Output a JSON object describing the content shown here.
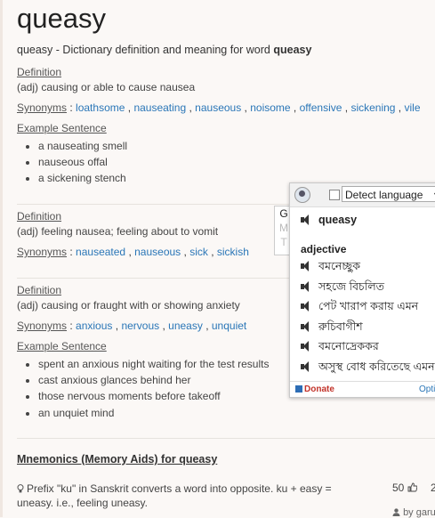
{
  "title": "queasy",
  "subtitle": {
    "text": "queasy - Dictionary definition and meaning for word ",
    "word": "queasy"
  },
  "labels": {
    "definition": "Definition",
    "synonyms": "Synonyms",
    "example": "Example Sentence",
    "synonyms_sep": " : "
  },
  "senses": [
    {
      "def": "(adj) causing or able to cause nausea",
      "synonyms": [
        "loathsome",
        "nauseating",
        "nauseous",
        "noisome",
        "offensive",
        "sickening",
        "vile"
      ],
      "examples": [
        "a nauseating smell",
        "nauseous offal",
        "a sickening stench"
      ]
    },
    {
      "def": "(adj) feeling nausea; feeling about to vomit",
      "synonyms": [
        "nauseated",
        "nauseous",
        "sick",
        "sickish"
      ],
      "examples": []
    },
    {
      "def": "(adj) causing or fraught with or showing anxiety",
      "synonyms": [
        "anxious",
        "nervous",
        "uneasy",
        "unquiet"
      ],
      "examples": [
        "spent an anxious night waiting for the test results",
        "cast anxious glances behind her",
        "those nervous moments before takeoff",
        "an unquiet mind"
      ]
    }
  ],
  "mnemonics": {
    "title": "Mnemonics (Memory Aids) for queasy",
    "text": "Prefix \"ku\" in Sanskrit converts a word into opposite. ku + easy = uneasy. i.e., feeling uneasy.",
    "votes": "50",
    "votes_other": "2",
    "author": "by garu"
  },
  "translate_popup": {
    "detect_label": "Detect language",
    "gmt": [
      "G",
      "M",
      "T"
    ],
    "word": "queasy",
    "pos": "adjective",
    "translations": [
      "বমনেচ্ছুক",
      "সহজে বিচলিত",
      "পেট খারাপ করায় এমন",
      "রুচিবাগীশ",
      "বমনোদ্রেককর",
      "অসুস্থ বোধ করিতেছে এমন"
    ],
    "donate": "Donate",
    "options": "Opti"
  },
  "colors": {
    "link": "#2a76b7",
    "background": "#fbf8f6",
    "donate": "#c2332a"
  }
}
